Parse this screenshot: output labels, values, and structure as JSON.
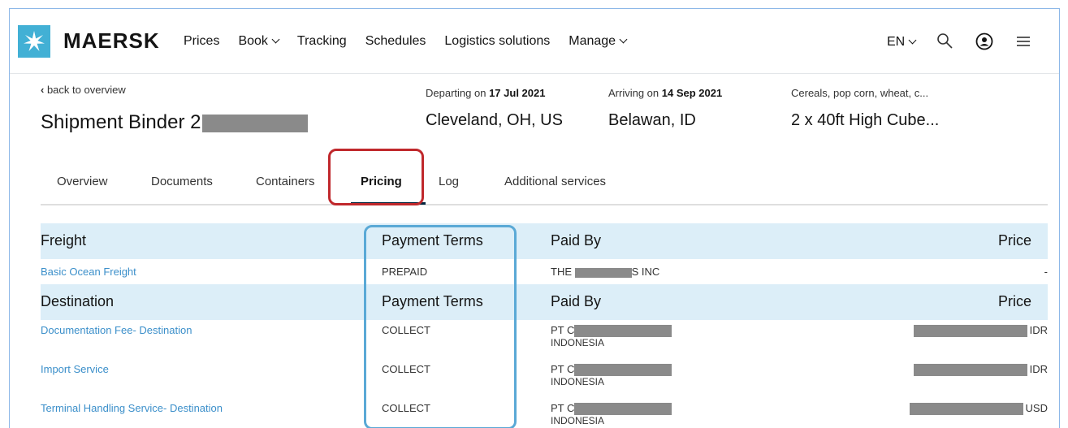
{
  "brand": {
    "name": "MAERSK",
    "logo_icon": "star-icon",
    "accent": "#42b0d5"
  },
  "nav": {
    "items": [
      {
        "label": "Prices",
        "dropdown": false
      },
      {
        "label": "Book",
        "dropdown": true
      },
      {
        "label": "Tracking",
        "dropdown": false
      },
      {
        "label": "Schedules",
        "dropdown": false
      },
      {
        "label": "Logistics solutions",
        "dropdown": false
      },
      {
        "label": "Manage",
        "dropdown": true
      }
    ],
    "language": "EN",
    "icons": [
      "search-icon",
      "user-icon",
      "menu-icon"
    ]
  },
  "shipment": {
    "back_label": "back to overview",
    "title_prefix": "Shipment Binder 2",
    "departing_label": "Departing on",
    "departing_date": "17 Jul 2021",
    "departing_place": "Cleveland, OH, US",
    "arriving_label": "Arriving on",
    "arriving_date": "14 Sep 2021",
    "arriving_place": "Belawan, ID",
    "cargo_desc": "Cereals, pop corn, wheat, c...",
    "cargo_containers": "2 x 40ft High Cube..."
  },
  "tabs": {
    "items": [
      "Overview",
      "Documents",
      "Containers",
      "Pricing",
      "Log",
      "Additional services"
    ],
    "active": "Pricing"
  },
  "pricing": {
    "sections": [
      {
        "name": "Freight",
        "col_payment": "Payment Terms",
        "col_paid_by": "Paid By",
        "col_price": "Price",
        "rows": [
          {
            "charge": "Basic Ocean Freight",
            "terms": "PREPAID",
            "paid_by_prefix": "THE",
            "paid_by_suffix": "S INC",
            "paid_by_line2": "",
            "price": "-",
            "currency": ""
          }
        ]
      },
      {
        "name": "Destination",
        "col_payment": "Payment Terms",
        "col_paid_by": "Paid By",
        "col_price": "Price",
        "rows": [
          {
            "charge": "Documentation Fee- Destination",
            "terms": "COLLECT",
            "paid_by_prefix": "PT C",
            "paid_by_suffix": "",
            "paid_by_line2": "INDONESIA",
            "price": "",
            "currency": "IDR"
          },
          {
            "charge": "Import Service",
            "terms": "COLLECT",
            "paid_by_prefix": "PT C",
            "paid_by_suffix": "",
            "paid_by_line2": "INDONESIA",
            "price": "",
            "currency": "IDR"
          },
          {
            "charge": "Terminal Handling Service- Destination",
            "terms": "COLLECT",
            "paid_by_prefix": "PT C",
            "paid_by_suffix": "",
            "paid_by_line2": "INDONESIA",
            "price": "",
            "currency": "USD"
          }
        ]
      }
    ]
  },
  "colors": {
    "link": "#3b8fca",
    "section_band": "#dceef8",
    "highlight_red": "#c0282c",
    "highlight_blue": "#5aa9d6",
    "active_tab": "#00243d"
  }
}
